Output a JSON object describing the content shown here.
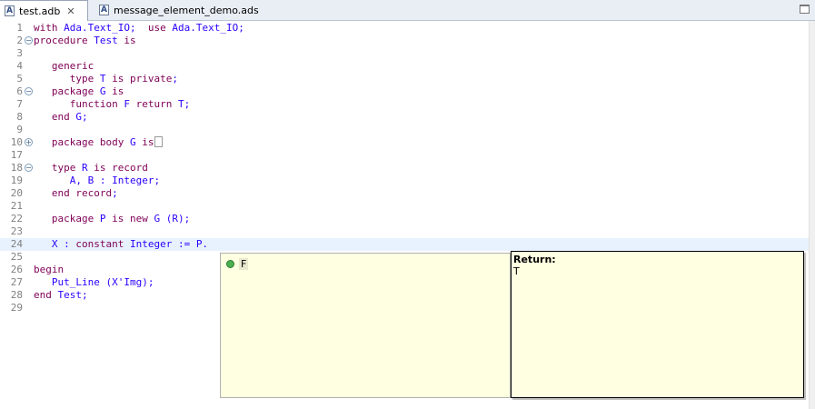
{
  "tabs": [
    {
      "label": "test.adb",
      "icon": "ada-file-icon",
      "close": "✕",
      "active": true
    },
    {
      "label": "message_element_demo.ads",
      "icon": "ada-file-icon",
      "active": false
    }
  ],
  "editor": {
    "lines": [
      {
        "num": "1",
        "code": "with Ada.Text_IO;  use Ada.Text_IO;"
      },
      {
        "num": "2",
        "code": "procedure Test is"
      },
      {
        "num": "3",
        "code": ""
      },
      {
        "num": "4",
        "code": "   generic"
      },
      {
        "num": "5",
        "code": "      type T is private;"
      },
      {
        "num": "6",
        "code": "   package G is"
      },
      {
        "num": "7",
        "code": "      function F return T;"
      },
      {
        "num": "8",
        "code": "   end G;"
      },
      {
        "num": "9",
        "code": ""
      },
      {
        "num": "10",
        "code": "   package body G is"
      },
      {
        "num": "17",
        "code": ""
      },
      {
        "num": "18",
        "code": "   type R is record"
      },
      {
        "num": "19",
        "code": "      A, B : Integer;"
      },
      {
        "num": "20",
        "code": "   end record;"
      },
      {
        "num": "21",
        "code": ""
      },
      {
        "num": "22",
        "code": "   package P is new G (R);"
      },
      {
        "num": "23",
        "code": ""
      },
      {
        "num": "24",
        "code": "   X : constant Integer := P."
      },
      {
        "num": "25",
        "code": ""
      },
      {
        "num": "26",
        "code": "begin"
      },
      {
        "num": "27",
        "code": "   Put_Line (X'Img);"
      },
      {
        "num": "28",
        "code": "end Test;"
      },
      {
        "num": "29",
        "code": ""
      }
    ]
  },
  "completion": {
    "items": [
      {
        "label": "F",
        "icon": "function-green-dot-icon"
      }
    ],
    "doc_title": "Return:",
    "doc_body": "T"
  }
}
